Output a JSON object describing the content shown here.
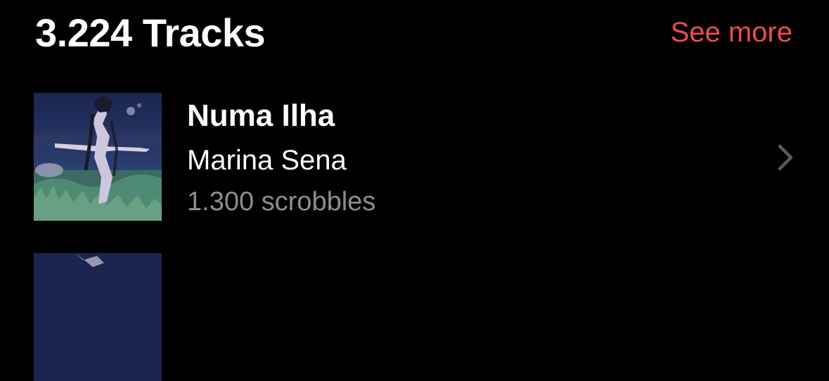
{
  "header": {
    "title": "3.224 Tracks",
    "see_more": "See more"
  },
  "tracks": [
    {
      "name": "Numa Ilha",
      "artist": "Marina Sena",
      "scrobbles": "1.300 scrobbles"
    },
    {
      "name": "",
      "artist": "",
      "scrobbles": ""
    }
  ],
  "colors": {
    "background": "#000000",
    "accent": "#eb4d4d",
    "secondary_text": "#8e8e93",
    "chevron": "#5a5a5e"
  },
  "icons": {
    "disclosure": "chevron-right-icon"
  }
}
